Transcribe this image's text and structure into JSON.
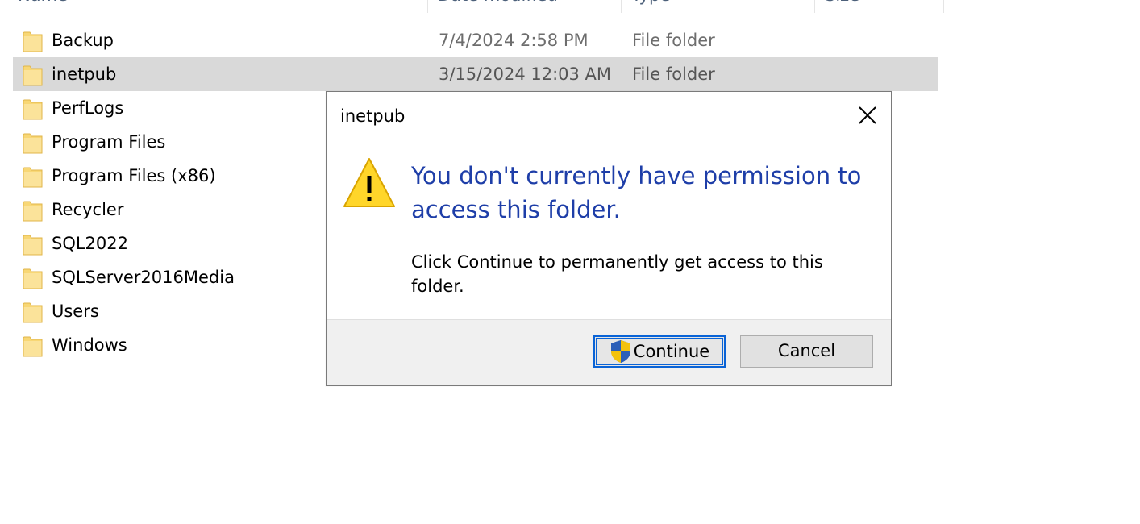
{
  "columns": {
    "name": "Name",
    "date_modified": "Date modified",
    "type": "Type",
    "size": "Size"
  },
  "files": [
    {
      "name": "Backup",
      "date": "7/4/2024 2:58 PM",
      "type": "File folder",
      "selected": false
    },
    {
      "name": "inetpub",
      "date": "3/15/2024 12:03 AM",
      "type": "File folder",
      "selected": true
    },
    {
      "name": "PerfLogs",
      "date": "",
      "type": "",
      "selected": false
    },
    {
      "name": "Program Files",
      "date": "",
      "type": "",
      "selected": false
    },
    {
      "name": "Program Files (x86)",
      "date": "",
      "type": "",
      "selected": false
    },
    {
      "name": "Recycler",
      "date": "",
      "type": "",
      "selected": false
    },
    {
      "name": "SQL2022",
      "date": "",
      "type": "",
      "selected": false
    },
    {
      "name": "SQLServer2016Media",
      "date": "",
      "type": "",
      "selected": false
    },
    {
      "name": "Users",
      "date": "",
      "type": "",
      "selected": false
    },
    {
      "name": "Windows",
      "date": "",
      "type": "",
      "selected": false
    }
  ],
  "dialog": {
    "title": "inetpub",
    "main_instruction": "You don't currently have permission to access this folder.",
    "content": "Click Continue to permanently get access to this folder.",
    "continue_label": "Continue",
    "cancel_label": "Cancel",
    "icons": {
      "warning": "warning-icon",
      "close": "close-icon",
      "shield": "uac-shield-icon"
    }
  },
  "colors": {
    "selected_row": "#d9d9d9",
    "main_instruction": "#1e3ea8",
    "focus_border": "#0a63d6",
    "warning_fill": "#ffd62a",
    "folder_fill": "#f8d775"
  }
}
